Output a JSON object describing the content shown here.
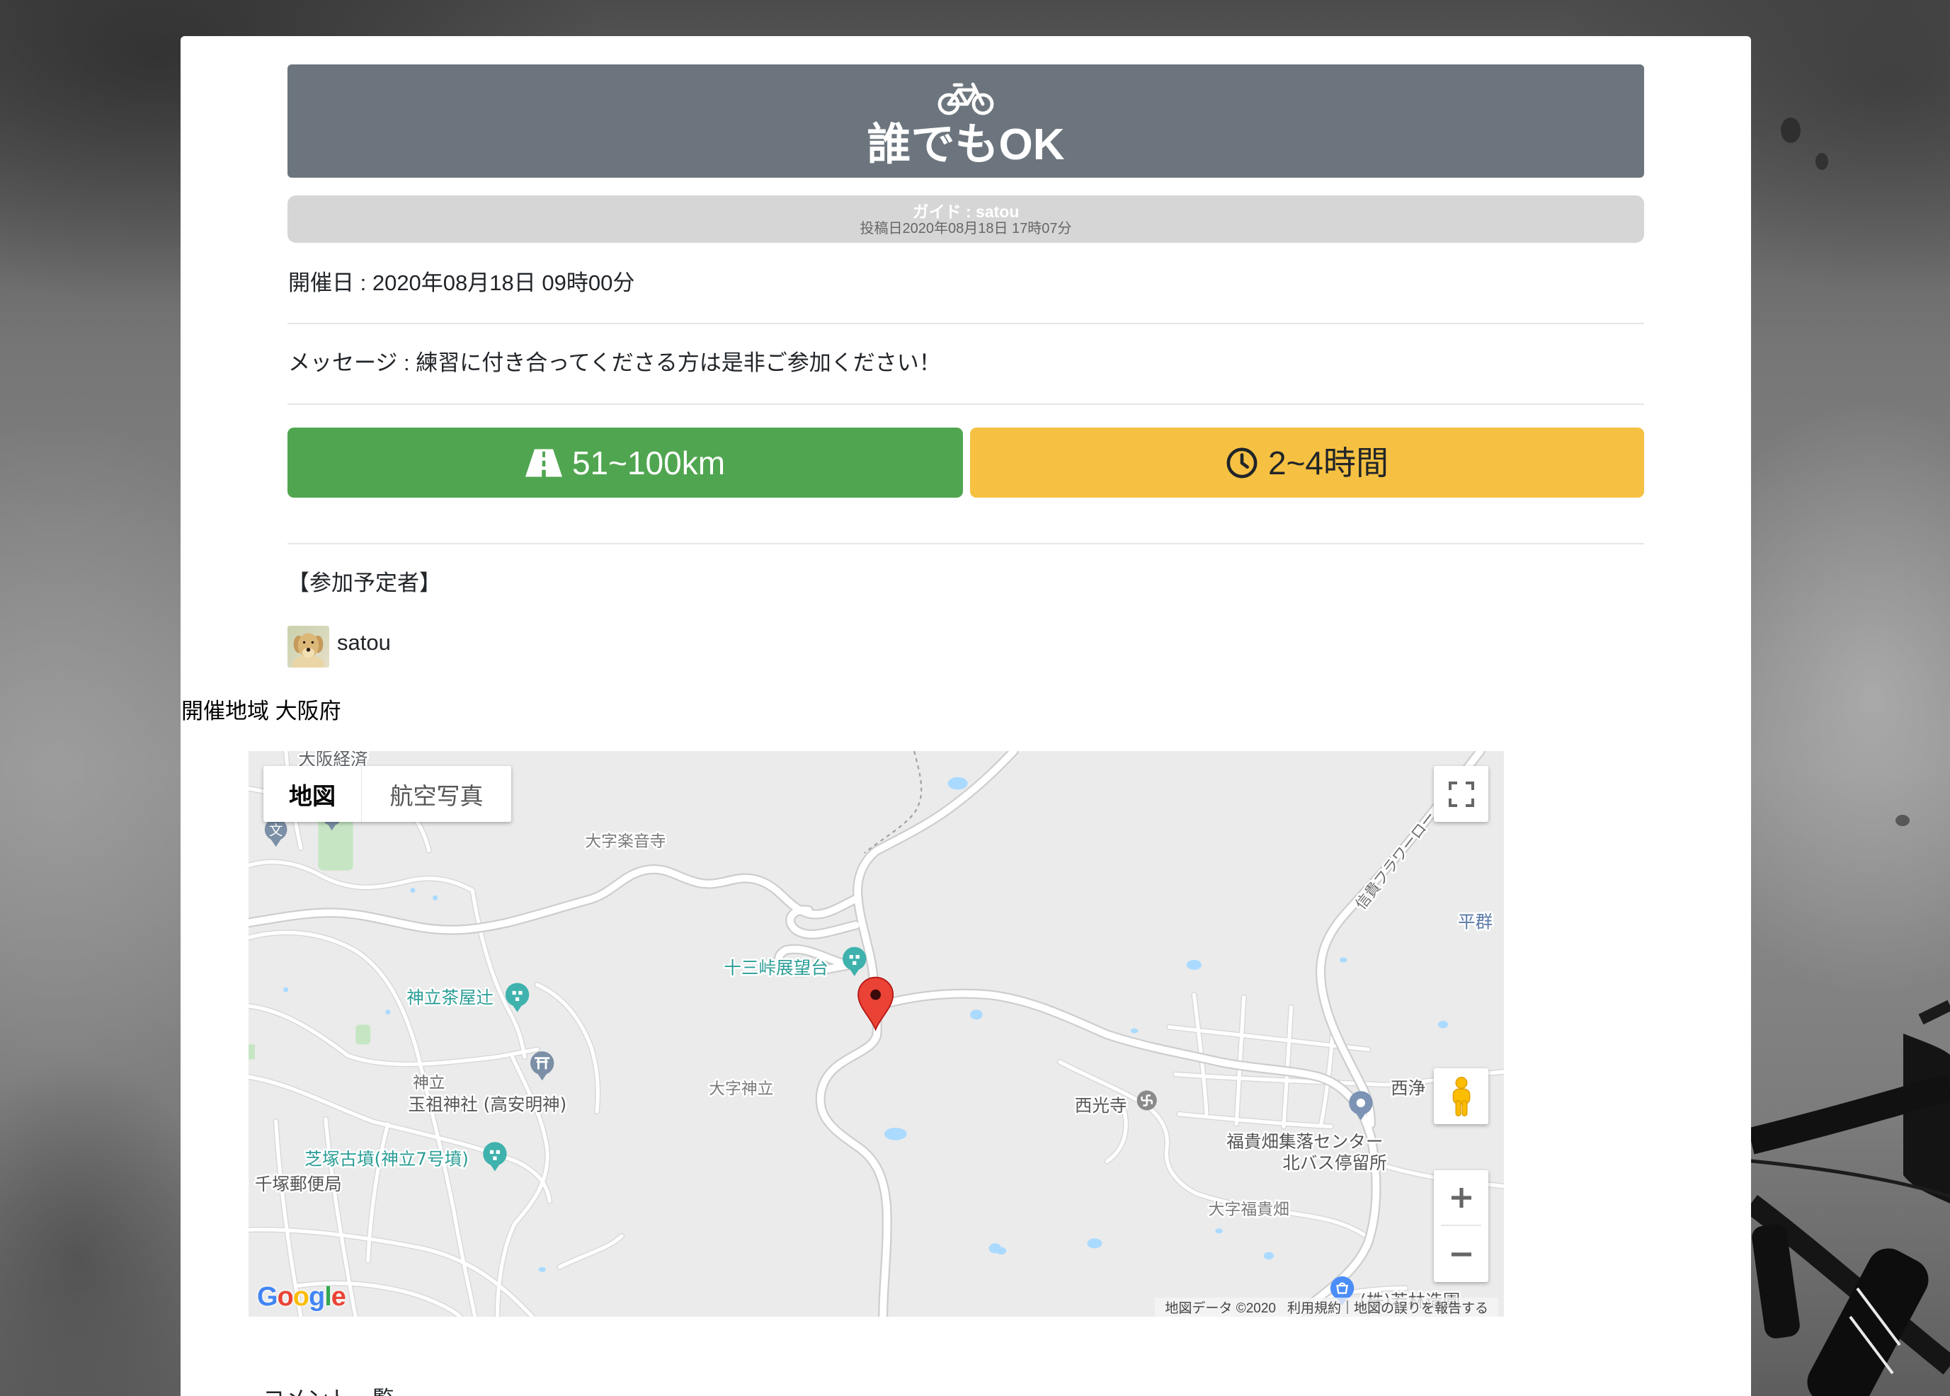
{
  "header": {
    "icon": "bicycle-icon",
    "title": "誰でもOK",
    "bg_color": "#6c757d"
  },
  "guide": {
    "label": "ガイド : satou",
    "posted": "投稿日2020年08月18日 17時07分"
  },
  "event": {
    "date": "開催日 : 2020年08月18日 09時00分",
    "message": "メッセージ : 練習に付き合ってくださる方は是非ご参加ください！"
  },
  "badges": {
    "distance": {
      "icon": "road-icon",
      "label": "51~100km",
      "color": "#50a650"
    },
    "duration": {
      "icon": "clock-icon",
      "label": "2~4時間",
      "color": "#f6c142"
    }
  },
  "participants": {
    "heading": "【参加予定者】",
    "list": [
      {
        "avatar": "dog-photo-avatar",
        "name": "satou"
      }
    ]
  },
  "region": {
    "label": "開催地域 大阪府"
  },
  "map": {
    "map_type": {
      "map": "地図",
      "satellite": "航空写真",
      "selected": "地図"
    },
    "controls": {
      "fullscreen": "fullscreen-icon",
      "street_view": "pegman-icon",
      "zoom_in": "plus-icon",
      "zoom_out": "minus-icon"
    },
    "marker": {
      "icon": "red-marker-icon",
      "color": "#ea4335"
    },
    "labels": {
      "osaka_keizai": "大阪経済",
      "rakuonji": "大字楽音寺",
      "jusan_toge": "十三峠展望台",
      "kandachi_chayatsuji": "神立茶屋辻",
      "kandachi": "神立",
      "tamaoya_jinja": "玉祖神社 (高安明神)",
      "shibazuka_kofun": "芝塚古墳(神立7号墳)",
      "senzuka_post": "千塚郵便局",
      "aza_kandachi": "大字神立",
      "saikoji": "西光寺",
      "fukihata_center": "福貴畑集落センター",
      "kita_bus_stop": "北バス停留所",
      "aza_fukihata": "大字福貴畑",
      "nishijo": "西浄",
      "heguri": "平群",
      "shigi_flower_road": "信貴フラワーロー",
      "wakabayashi": "(株)若林造園",
      "school_glyph": "文"
    },
    "attribution": {
      "logo": "Google",
      "logo_colors": [
        "#4285f4",
        "#ea4335",
        "#fbbc05",
        "#4285f4",
        "#34a853",
        "#ea4335"
      ],
      "data": "地図データ ©2020",
      "terms": "利用規約",
      "report": "地図の誤りを報告する"
    }
  },
  "comments": {
    "heading": "コメント一覧"
  }
}
